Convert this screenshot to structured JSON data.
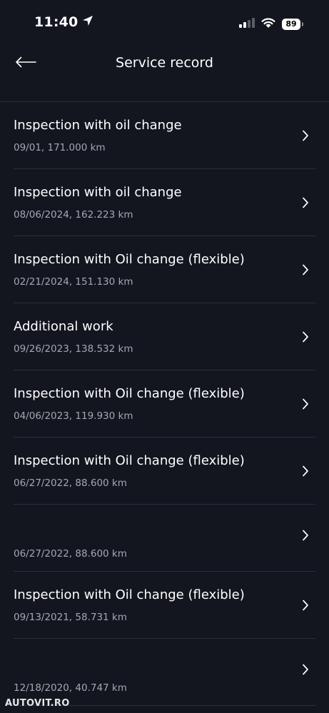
{
  "status_bar": {
    "time": "11:40",
    "battery": "89"
  },
  "header": {
    "title": "Service record"
  },
  "records": [
    {
      "title": "Inspection with oil change",
      "subtitle": "09/01, 171.000 km"
    },
    {
      "title": "Inspection with oil change",
      "subtitle": "08/06/2024, 162.223 km"
    },
    {
      "title": "Inspection with Oil change (flexible)",
      "subtitle": "02/21/2024, 151.130 km"
    },
    {
      "title": "Additional work",
      "subtitle": "09/26/2023, 138.532 km"
    },
    {
      "title": "Inspection with Oil change (flexible)",
      "subtitle": "04/06/2023, 119.930 km"
    },
    {
      "title": "Inspection with Oil change (flexible)",
      "subtitle": "06/27/2022, 88.600 km"
    },
    {
      "title": "",
      "subtitle": "06/27/2022, 88.600 km"
    },
    {
      "title": "Inspection with Oil change (flexible)",
      "subtitle": "09/13/2021, 58.731 km"
    },
    {
      "title": "",
      "subtitle": "12/18/2020, 40.747 km"
    }
  ],
  "watermark": "AUTOVIT.RO",
  "colors": {
    "background": "#13161f",
    "divider": "#2b2f39",
    "text_primary": "#ffffff",
    "text_secondary": "#a4a8b2"
  },
  "icons": {
    "back": "arrow-left-icon",
    "row_chevron": "chevron-right-icon",
    "location": "location-arrow-icon",
    "signal": "cellular-signal-icon",
    "wifi": "wifi-icon",
    "battery": "battery-icon"
  }
}
